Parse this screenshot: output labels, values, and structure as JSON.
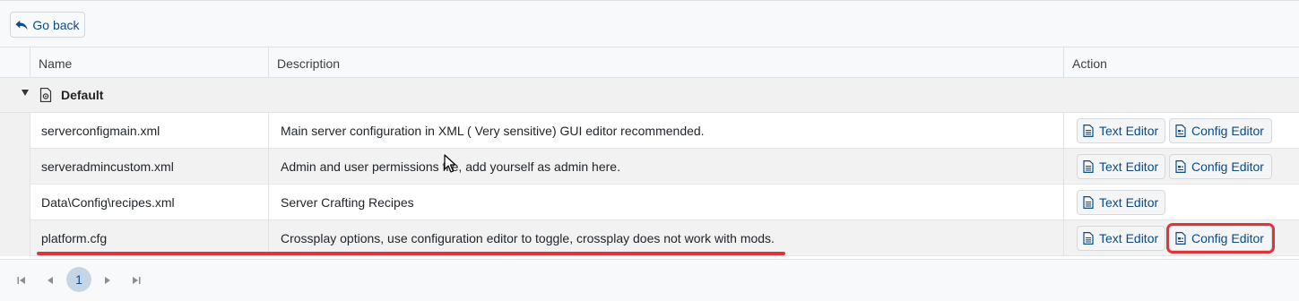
{
  "toolbar": {
    "go_back_label": "Go back"
  },
  "columns": {
    "name": "Name",
    "description": "Description",
    "action": "Action"
  },
  "group": {
    "label": "Default"
  },
  "rows": [
    {
      "name": "serverconfigmain.xml",
      "description": "Main server configuration in XML ( Very sensitive) GUI editor recommended.",
      "text_editor": "Text Editor",
      "config_editor": "Config Editor"
    },
    {
      "name": "serveradmincustom.xml",
      "description": "Admin and user permissions file, add yourself as admin here.",
      "text_editor": "Text Editor",
      "config_editor": "Config Editor"
    },
    {
      "name": "Data\\Config\\recipes.xml",
      "description": "Server Crafting Recipes",
      "text_editor": "Text Editor"
    },
    {
      "name": "platform.cfg",
      "description": "Crossplay options, use configuration editor to toggle, crossplay does not work with mods.",
      "text_editor": "Text Editor",
      "config_editor": "Config Editor"
    }
  ],
  "pager": {
    "current_page": "1"
  },
  "colors": {
    "link": "#0d4a86",
    "highlight": "#e0343a",
    "page_active": "#c4d6e6"
  },
  "icons": [
    "reply-arrow-icon",
    "document-gear-icon",
    "document-text-icon",
    "document-settings-icon",
    "first-page-icon",
    "prev-page-icon",
    "next-page-icon",
    "last-page-icon",
    "mouse-cursor-icon"
  ]
}
